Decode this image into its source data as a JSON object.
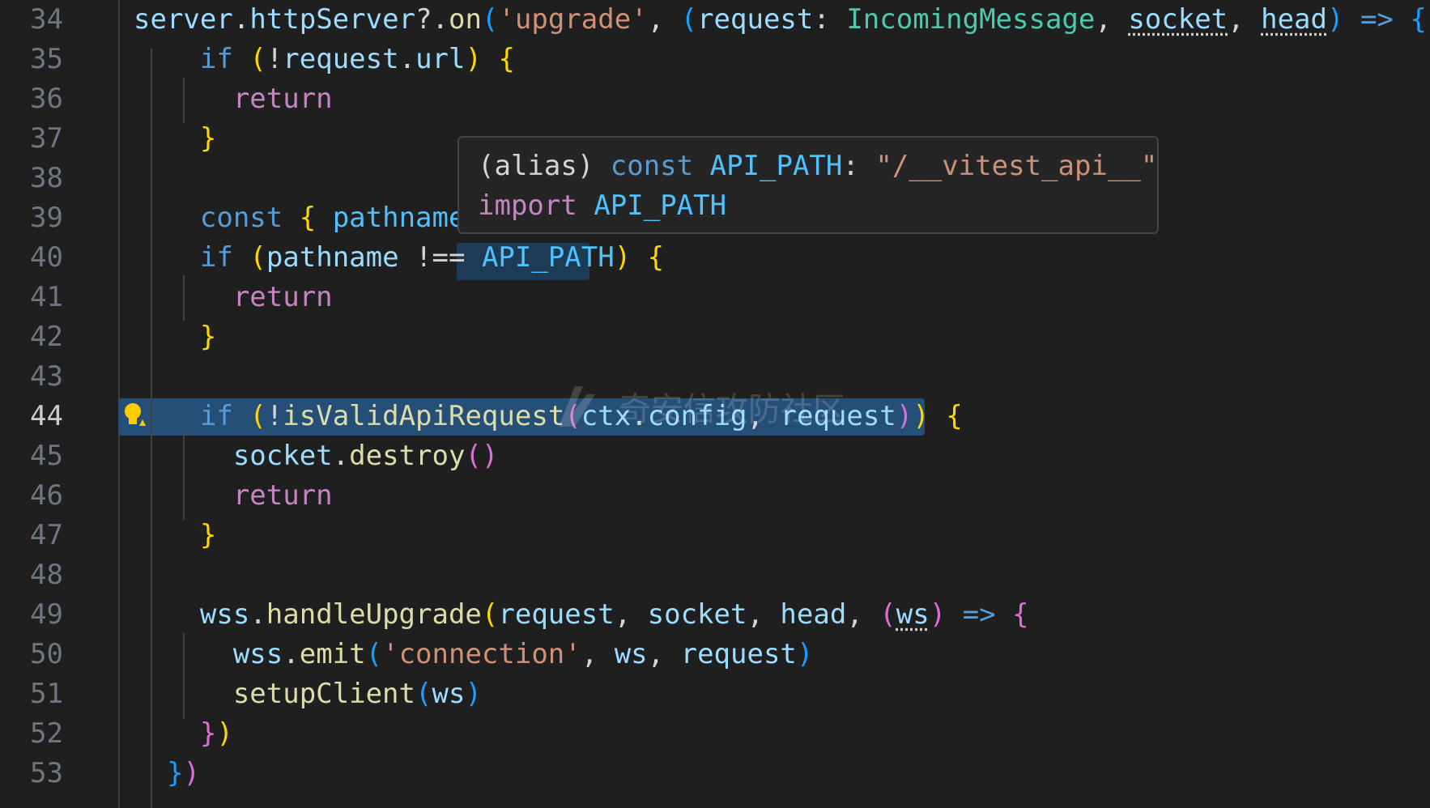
{
  "editor": {
    "active_line": "44",
    "watermark_text": "奇安信攻防社区",
    "lines": [
      {
        "num": "34",
        "tokens": [
          {
            "t": "server",
            "c": "t-var"
          },
          {
            "t": ".",
            "c": "t-p"
          },
          {
            "t": "httpServer",
            "c": "t-var"
          },
          {
            "t": "?.",
            "c": "t-p"
          },
          {
            "t": "on",
            "c": "t-fn"
          },
          {
            "t": "(",
            "c": "t-b3"
          },
          {
            "t": "'upgrade'",
            "c": "t-str"
          },
          {
            "t": ", ",
            "c": "t-p"
          },
          {
            "t": "(",
            "c": "t-b3"
          },
          {
            "t": "request",
            "c": "t-var"
          },
          {
            "t": ": ",
            "c": "t-p"
          },
          {
            "t": "IncomingMessage",
            "c": "t-type"
          },
          {
            "t": ", ",
            "c": "t-p"
          },
          {
            "t": "socket",
            "c": "t-var dotted"
          },
          {
            "t": ", ",
            "c": "t-p"
          },
          {
            "t": "head",
            "c": "t-var dotted"
          },
          {
            "t": ") ",
            "c": "t-b3"
          },
          {
            "t": "=> ",
            "c": "t-kw"
          },
          {
            "t": "{",
            "c": "t-b3"
          }
        ]
      },
      {
        "num": "35",
        "tokens": [
          {
            "t": "    ",
            "c": "t-p"
          },
          {
            "t": "if",
            "c": "t-kw"
          },
          {
            "t": " ",
            "c": "t-p"
          },
          {
            "t": "(",
            "c": "t-b1"
          },
          {
            "t": "!",
            "c": "t-p"
          },
          {
            "t": "request",
            "c": "t-var"
          },
          {
            "t": ".",
            "c": "t-p"
          },
          {
            "t": "url",
            "c": "t-var"
          },
          {
            "t": ")",
            "c": "t-b1"
          },
          {
            "t": " ",
            "c": "t-p"
          },
          {
            "t": "{",
            "c": "t-b1"
          }
        ]
      },
      {
        "num": "36",
        "tokens": [
          {
            "t": "      ",
            "c": "t-p"
          },
          {
            "t": "return",
            "c": "t-ctrl"
          }
        ]
      },
      {
        "num": "37",
        "tokens": [
          {
            "t": "    ",
            "c": "t-p"
          },
          {
            "t": "}",
            "c": "t-b1"
          }
        ]
      },
      {
        "num": "38",
        "tokens": []
      },
      {
        "num": "39",
        "tokens": [
          {
            "t": "    ",
            "c": "t-p"
          },
          {
            "t": "const",
            "c": "t-kw"
          },
          {
            "t": " ",
            "c": "t-p"
          },
          {
            "t": "{",
            "c": "t-b1"
          },
          {
            "t": " ",
            "c": "t-p"
          },
          {
            "t": "pathname",
            "c": "t-const"
          }
        ]
      },
      {
        "num": "40",
        "tokens": [
          {
            "t": "    ",
            "c": "t-p"
          },
          {
            "t": "if",
            "c": "t-kw"
          },
          {
            "t": " ",
            "c": "t-p"
          },
          {
            "t": "(",
            "c": "t-b1"
          },
          {
            "t": "pathname",
            "c": "t-var"
          },
          {
            "t": " !== ",
            "c": "t-p"
          },
          {
            "t": "API_PATH",
            "c": "t-const"
          },
          {
            "t": ")",
            "c": "t-b1"
          },
          {
            "t": " ",
            "c": "t-p"
          },
          {
            "t": "{",
            "c": "t-b1"
          }
        ]
      },
      {
        "num": "41",
        "tokens": [
          {
            "t": "      ",
            "c": "t-p"
          },
          {
            "t": "return",
            "c": "t-ctrl"
          }
        ]
      },
      {
        "num": "42",
        "tokens": [
          {
            "t": "    ",
            "c": "t-p"
          },
          {
            "t": "}",
            "c": "t-b1"
          }
        ]
      },
      {
        "num": "43",
        "tokens": []
      },
      {
        "num": "44",
        "tokens": [
          {
            "t": "    ",
            "c": "t-p"
          },
          {
            "t": "if",
            "c": "t-kw"
          },
          {
            "t": " ",
            "c": "t-p"
          },
          {
            "t": "(",
            "c": "t-b1"
          },
          {
            "t": "!",
            "c": "t-p"
          },
          {
            "t": "isValidApiRequest",
            "c": "t-fn"
          },
          {
            "t": "(",
            "c": "t-b2"
          },
          {
            "t": "ctx",
            "c": "t-var"
          },
          {
            "t": ".",
            "c": "t-p"
          },
          {
            "t": "config",
            "c": "t-var"
          },
          {
            "t": ", ",
            "c": "t-p"
          },
          {
            "t": "request",
            "c": "t-var"
          },
          {
            "t": ")",
            "c": "t-b2"
          },
          {
            "t": ")",
            "c": "t-b1"
          },
          {
            "t": " ",
            "c": "t-p"
          },
          {
            "t": "{",
            "c": "t-b1"
          }
        ]
      },
      {
        "num": "45",
        "tokens": [
          {
            "t": "      ",
            "c": "t-p"
          },
          {
            "t": "socket",
            "c": "t-var"
          },
          {
            "t": ".",
            "c": "t-p"
          },
          {
            "t": "destroy",
            "c": "t-fn"
          },
          {
            "t": "()",
            "c": "t-b2"
          }
        ]
      },
      {
        "num": "46",
        "tokens": [
          {
            "t": "      ",
            "c": "t-p"
          },
          {
            "t": "return",
            "c": "t-ctrl"
          }
        ]
      },
      {
        "num": "47",
        "tokens": [
          {
            "t": "    ",
            "c": "t-p"
          },
          {
            "t": "}",
            "c": "t-b1"
          }
        ]
      },
      {
        "num": "48",
        "tokens": []
      },
      {
        "num": "49",
        "tokens": [
          {
            "t": "    ",
            "c": "t-p"
          },
          {
            "t": "wss",
            "c": "t-var"
          },
          {
            "t": ".",
            "c": "t-p"
          },
          {
            "t": "handleUpgrade",
            "c": "t-fn"
          },
          {
            "t": "(",
            "c": "t-b1"
          },
          {
            "t": "request",
            "c": "t-var"
          },
          {
            "t": ", ",
            "c": "t-p"
          },
          {
            "t": "socket",
            "c": "t-var"
          },
          {
            "t": ", ",
            "c": "t-p"
          },
          {
            "t": "head",
            "c": "t-var"
          },
          {
            "t": ", ",
            "c": "t-p"
          },
          {
            "t": "(",
            "c": "t-b2"
          },
          {
            "t": "ws",
            "c": "t-var dotted"
          },
          {
            "t": ")",
            "c": "t-b2"
          },
          {
            "t": " ",
            "c": "t-p"
          },
          {
            "t": "=>",
            "c": "t-kw"
          },
          {
            "t": " ",
            "c": "t-p"
          },
          {
            "t": "{",
            "c": "t-b2"
          }
        ]
      },
      {
        "num": "50",
        "tokens": [
          {
            "t": "      ",
            "c": "t-p"
          },
          {
            "t": "wss",
            "c": "t-var"
          },
          {
            "t": ".",
            "c": "t-p"
          },
          {
            "t": "emit",
            "c": "t-fn"
          },
          {
            "t": "(",
            "c": "t-b3"
          },
          {
            "t": "'connection'",
            "c": "t-str"
          },
          {
            "t": ", ",
            "c": "t-p"
          },
          {
            "t": "ws",
            "c": "t-var"
          },
          {
            "t": ", ",
            "c": "t-p"
          },
          {
            "t": "request",
            "c": "t-var"
          },
          {
            "t": ")",
            "c": "t-b3"
          }
        ]
      },
      {
        "num": "51",
        "tokens": [
          {
            "t": "      ",
            "c": "t-p"
          },
          {
            "t": "setupClient",
            "c": "t-fn"
          },
          {
            "t": "(",
            "c": "t-b3"
          },
          {
            "t": "ws",
            "c": "t-var"
          },
          {
            "t": ")",
            "c": "t-b3"
          }
        ]
      },
      {
        "num": "52",
        "tokens": [
          {
            "t": "    ",
            "c": "t-p"
          },
          {
            "t": "}",
            "c": "t-b2"
          },
          {
            "t": ")",
            "c": "t-b1"
          }
        ]
      },
      {
        "num": "53",
        "tokens": [
          {
            "t": "  ",
            "c": "t-p"
          },
          {
            "t": "}",
            "c": "t-b3"
          },
          {
            "t": ")",
            "c": "t-b2"
          }
        ]
      }
    ]
  },
  "hover": {
    "line1_tokens": [
      {
        "t": "(alias) ",
        "c": "t-p"
      },
      {
        "t": "const",
        "c": "t-kw"
      },
      {
        "t": " ",
        "c": "t-p"
      },
      {
        "t": "API_PATH",
        "c": "t-const"
      },
      {
        "t": ": ",
        "c": "t-p"
      },
      {
        "t": "\"/__vitest_api__\"",
        "c": "t-str"
      }
    ],
    "line2_tokens": [
      {
        "t": "import",
        "c": "t-ctrl"
      },
      {
        "t": " ",
        "c": "t-p"
      },
      {
        "t": "API_PATH",
        "c": "t-const"
      }
    ]
  },
  "colors": {
    "background": "#1f1f1f",
    "selection": "#264f78",
    "hover_bg": "#252526"
  }
}
